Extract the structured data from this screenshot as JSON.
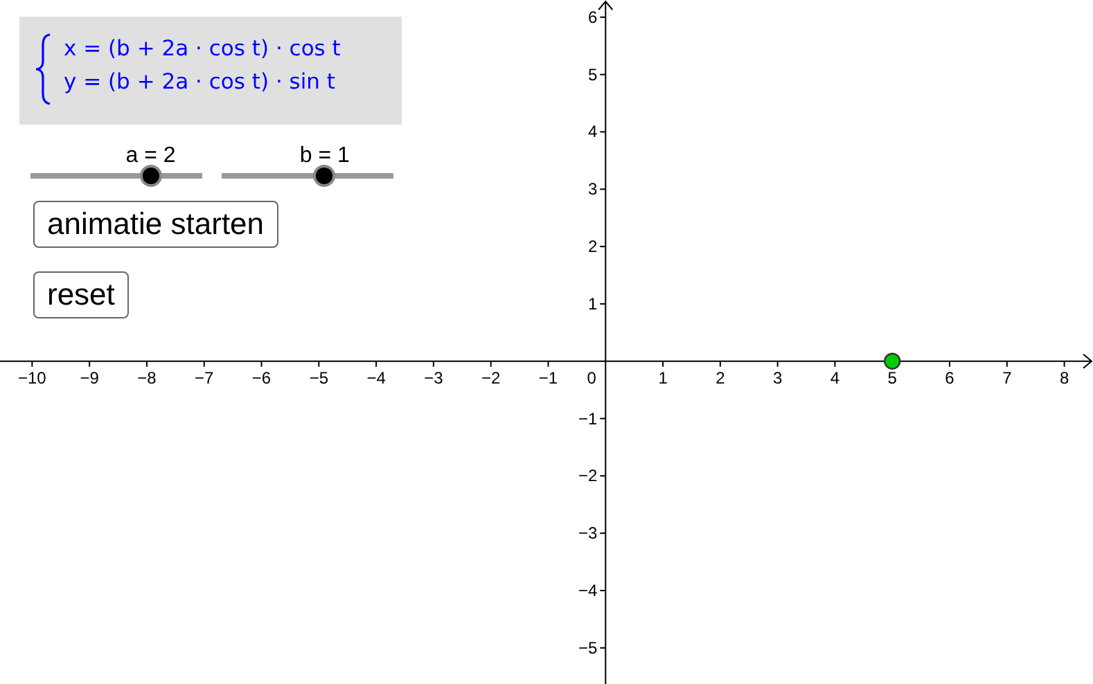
{
  "equations": [
    {
      "text": "x = (b + 2a · cos t) · cos t"
    },
    {
      "text": "y = (b + 2a · cos t) · sin t"
    }
  ],
  "sliders": [
    {
      "label": "a = 2",
      "level": 0.7
    },
    {
      "label": "b = 1",
      "level": 0.6
    }
  ],
  "buttons": [
    "animatie starten",
    "reset"
  ],
  "graph": {
    "origin_label": "0",
    "chart_data": {
      "type": "scatter",
      "x": [
        5
      ],
      "values": [
        0
      ],
      "xlim": [
        -10.56,
        8.5
      ],
      "ylim": [
        -5.63,
        6.3
      ],
      "xticks": [
        -10,
        -9,
        -8,
        -7,
        -6,
        -5,
        -4,
        -3,
        -2,
        -1,
        1,
        2,
        3,
        4,
        5,
        6,
        7,
        8
      ],
      "yticks": [
        -5,
        -4,
        -3,
        -2,
        -1,
        1,
        2,
        3,
        4,
        5,
        6
      ]
    }
  }
}
